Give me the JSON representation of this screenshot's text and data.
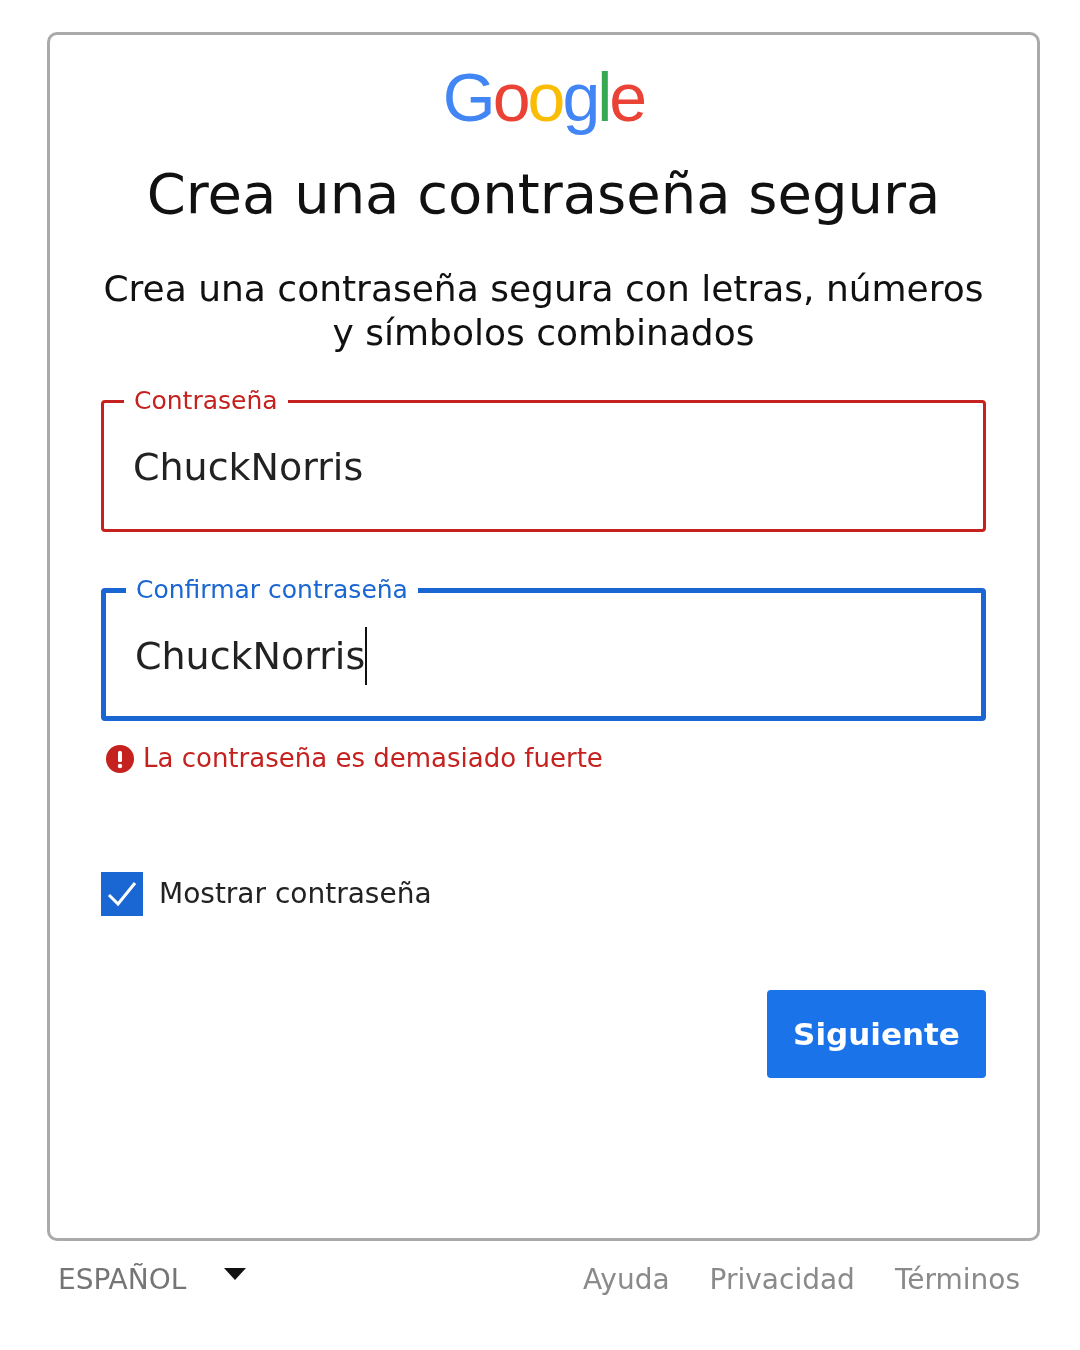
{
  "logo": "Google",
  "title": "Crea una contraseña segura",
  "subtitle": "Crea una contraseña segura con letras, números y símbolos combinados",
  "fields": [
    {
      "label": "Contraseña",
      "value": "ChuckNorris",
      "error": true,
      "focused": false
    },
    {
      "label": "Confirmar contraseña",
      "value": "ChuckNorris",
      "error": false,
      "focused": true
    }
  ],
  "error_message": "La contraseña es demasiado fuerte",
  "show_password": {
    "label": "Mostrar contraseña",
    "checked": true
  },
  "next_button": "Siguiente",
  "footer": {
    "language": "ESPAÑOL",
    "links": [
      "Ayuda",
      "Privacidad",
      "Términos"
    ]
  }
}
